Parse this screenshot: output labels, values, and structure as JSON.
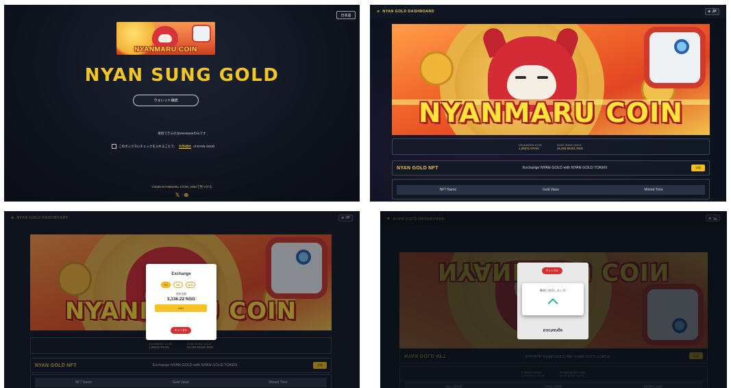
{
  "panel1": {
    "lang_button": "日本語",
    "banner_label": "NYANMARU COIN",
    "hero_title": "NYAN SUNG GOLD",
    "wallet_button": "ウォレット接続",
    "connect_note": "接続できるのはMetaMaskのみです",
    "agree_prefix": "このボックスにチェックを入れることで、",
    "agree_terms": "利用規約",
    "agree_suffix": "of NYAN GOLD",
    "footer_copy": "©2025 NYANMARU COIN | SNSで見つける",
    "social_x": "𝕏",
    "social_web": "⊕"
  },
  "dashboard": {
    "title": "NYAN GOLD DASHBOARD",
    "lang": "⊕ JP",
    "banner_label": "NYANMARU COIN",
    "stats": [
      {
        "label": "NYANMARU COIN",
        "value": "1,28231 NYAN"
      },
      {
        "label": "NYAN SUNG GOLD",
        "value": "16,283.55181 NSG"
      }
    ],
    "nft_title": "NYAN GOLD NFT",
    "nft_desc": "Exchange NYAN GOLD with NYAN GOLD TOKEN",
    "nft_button": "交換",
    "table_headers": [
      "NFT Name",
      "Gold Value",
      "Minted Time"
    ]
  },
  "exchange_modal": {
    "title": "Exchange",
    "percentages": [
      "1%",
      "5%",
      "10%"
    ],
    "balance_label": "保有金額",
    "balance_value": "3,136.22 NSG",
    "exchange_button": "NSH",
    "cancel_button": "キャンセル"
  },
  "success_modal": {
    "message": "撤退に成功しました!",
    "cancel_button": "キャンセル",
    "title": "Exchange"
  }
}
